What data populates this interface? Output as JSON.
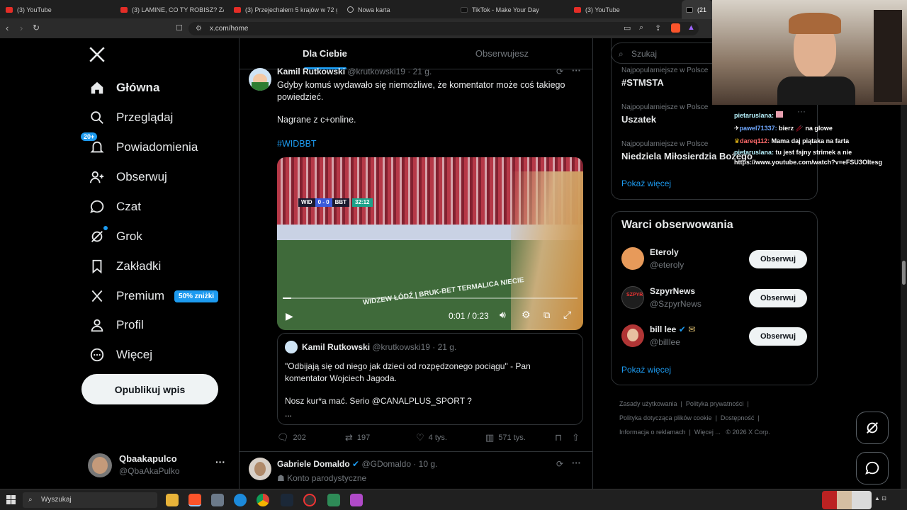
{
  "browser": {
    "tabs": [
      {
        "label": "(3) YouTube",
        "icon": "youtube-favicon-icon"
      },
      {
        "label": "(3) LAMINE, CO TY ROBISZ? ZABAW",
        "icon": "youtube-favicon-icon"
      },
      {
        "label": "(3) Przejechałem 5 krajów w 72 god",
        "icon": "youtube-favicon-icon"
      },
      {
        "label": "Nowa karta",
        "icon": "new-tab-icon"
      },
      {
        "label": "TikTok - Make Your Day",
        "icon": "tiktok-favicon-icon"
      },
      {
        "label": "(3) YouTube",
        "icon": "youtube-favicon-icon"
      },
      {
        "label": "(21",
        "icon": "x-favicon-icon"
      }
    ],
    "url": "x.com/home"
  },
  "nav": {
    "items": [
      {
        "label": "Główna",
        "icon": "home-icon"
      },
      {
        "label": "Przeglądaj",
        "icon": "search-icon"
      },
      {
        "label": "Powiadomienia",
        "icon": "bell-icon",
        "badge": "20+"
      },
      {
        "label": "Obserwuj",
        "icon": "follow-icon"
      },
      {
        "label": "Czat",
        "icon": "chat-icon"
      },
      {
        "label": "Grok",
        "icon": "grok-icon"
      },
      {
        "label": "Zakładki",
        "icon": "bookmark-icon"
      },
      {
        "label": "Premium",
        "icon": "x-logo-icon",
        "badge": "50% zniżki"
      },
      {
        "label": "Profil",
        "icon": "profile-icon"
      },
      {
        "label": "Więcej",
        "icon": "more-icon"
      }
    ],
    "post_label": "Opublikuj wpis",
    "profile": {
      "name": "Qbaakapulco",
      "handle": "@QbaAkaPulko"
    }
  },
  "feed": {
    "tabs": [
      "Dla Ciebie",
      "Obserwujesz"
    ],
    "post": {
      "author": "Kamil Rutkowski",
      "handle": "@krutkowski19",
      "time": "· 21 g.",
      "text1": "Gdyby komuś wydawało się niemożliwe, że komentator może coś takiego powiedzieć.",
      "text2": "Nagrane z c+online.",
      "hashtag": "#WIDBBT",
      "video": {
        "time": "0:01 / 0:23",
        "score_home": "WID",
        "score": "0 - 0",
        "score_away": "BBT",
        "clock": "32:12",
        "banner": "WIDZEW ŁÓDŹ | BRUK-BET TERMALICA NIECIE"
      },
      "quote": {
        "author": "Kamil Rutkowski",
        "handle": "@krutkowski19",
        "time": "· 21 g.",
        "text1": "\"Odbijają się od niego jak dzieci od rozpędzonego pociągu\" - Pan komentator Wojciech Jagoda.",
        "text2": "Nosz kur*a mać. Serio @CANALPLUS_SPORT ?",
        "text3": "..."
      },
      "stats": {
        "replies": "202",
        "reposts": "197",
        "likes": "4 tys.",
        "views": "571 tys."
      }
    },
    "next_post": {
      "author": "Gabriele Domaldo",
      "handle": "@GDomaldo",
      "time": "· 10 g.",
      "subtitle": "Konto parodystyczne"
    }
  },
  "right": {
    "search_placeholder": "Szukaj",
    "trends": [
      {
        "category": "Najpopularniejsze w Polsce",
        "name": "#STMSTA"
      },
      {
        "category": "Najpopularniejsze w Polsce",
        "name": "Uszatek"
      },
      {
        "category": "Najpopularniejsze w Polsce",
        "name": "Niedziela Miłosierdzia Bożego"
      }
    ],
    "show_more": "Pokaż więcej",
    "who_to_follow": {
      "title": "Warci obserwowania",
      "accounts": [
        {
          "name": "Eteroly",
          "handle": "@eteroly"
        },
        {
          "name": "SzpyrNews",
          "handle": "@SzpyrNews"
        },
        {
          "name": "bill lee",
          "handle": "@billlee"
        }
      ],
      "follow_label": "Obserwuj",
      "show_more": "Pokaż więcej"
    },
    "footer": [
      "Zasady użytkowania",
      "Polityka prywatności",
      "Polityka dotycząca plików cookie",
      "Dostępność",
      "Informacja o reklamach",
      "Więcej ...",
      "© 2026 X Corp."
    ]
  },
  "stream_chat": [
    {
      "user": "pietaruslana:",
      "msg": ""
    },
    {
      "user": "pawel71337:",
      "msg": "bierz 🥢 na glowe"
    },
    {
      "user": "dareq112:",
      "msg": "Mama daj piątaka na farta"
    },
    {
      "user": "pietaruslana:",
      "msg": "tu jest fajny strimek a nie https://www.youtube.com/watch?v=eFSU3Oltesg"
    }
  ],
  "taskbar": {
    "search": "Wyszukaj"
  },
  "colors": {
    "accent": "#1d9bf0",
    "background": "#000000",
    "border": "#2f3336"
  }
}
